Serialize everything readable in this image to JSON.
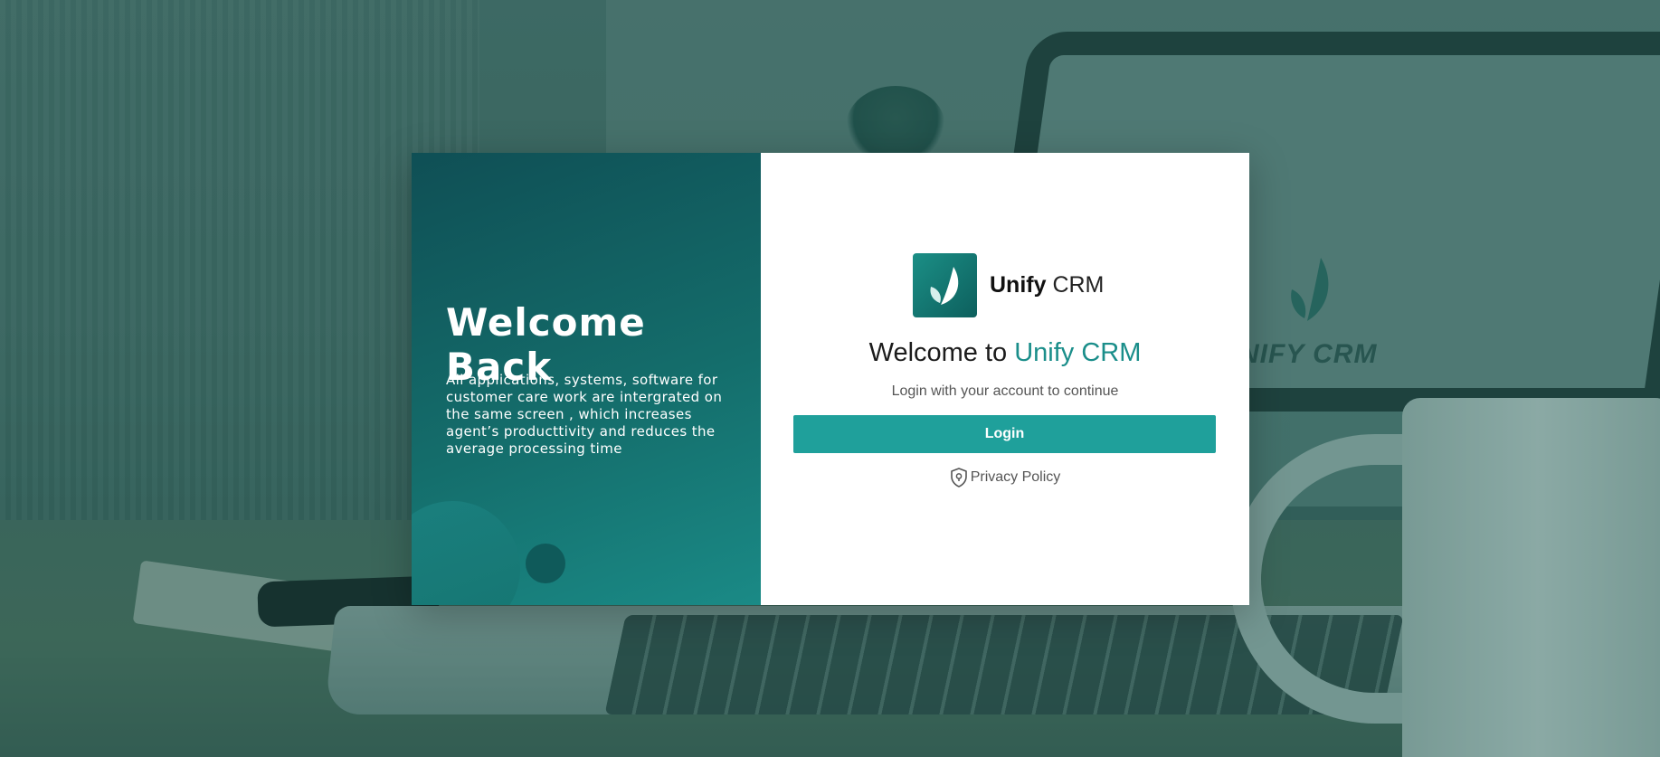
{
  "background": {
    "laptop_screen_text": "NIFY CRM"
  },
  "left_panel": {
    "title": "Welcome Back",
    "description": "All applications, systems, software for customer care work are intergrated on the same screen , which increases agent’s producttivity and reduces the average processing time"
  },
  "brand": {
    "name_bold": "Unify",
    "name_light": "CRM",
    "icon": "unify-logo-icon",
    "accent_color": "#1a8e8a"
  },
  "login_form": {
    "headline_prefix": "Welcome to ",
    "headline_accent": "Unify CRM",
    "subtitle": "Login with your account to continue",
    "login_button_label": "Login",
    "privacy_label": "Privacy Policy",
    "privacy_icon": "shield-icon",
    "button_color": "#1fa09b"
  }
}
